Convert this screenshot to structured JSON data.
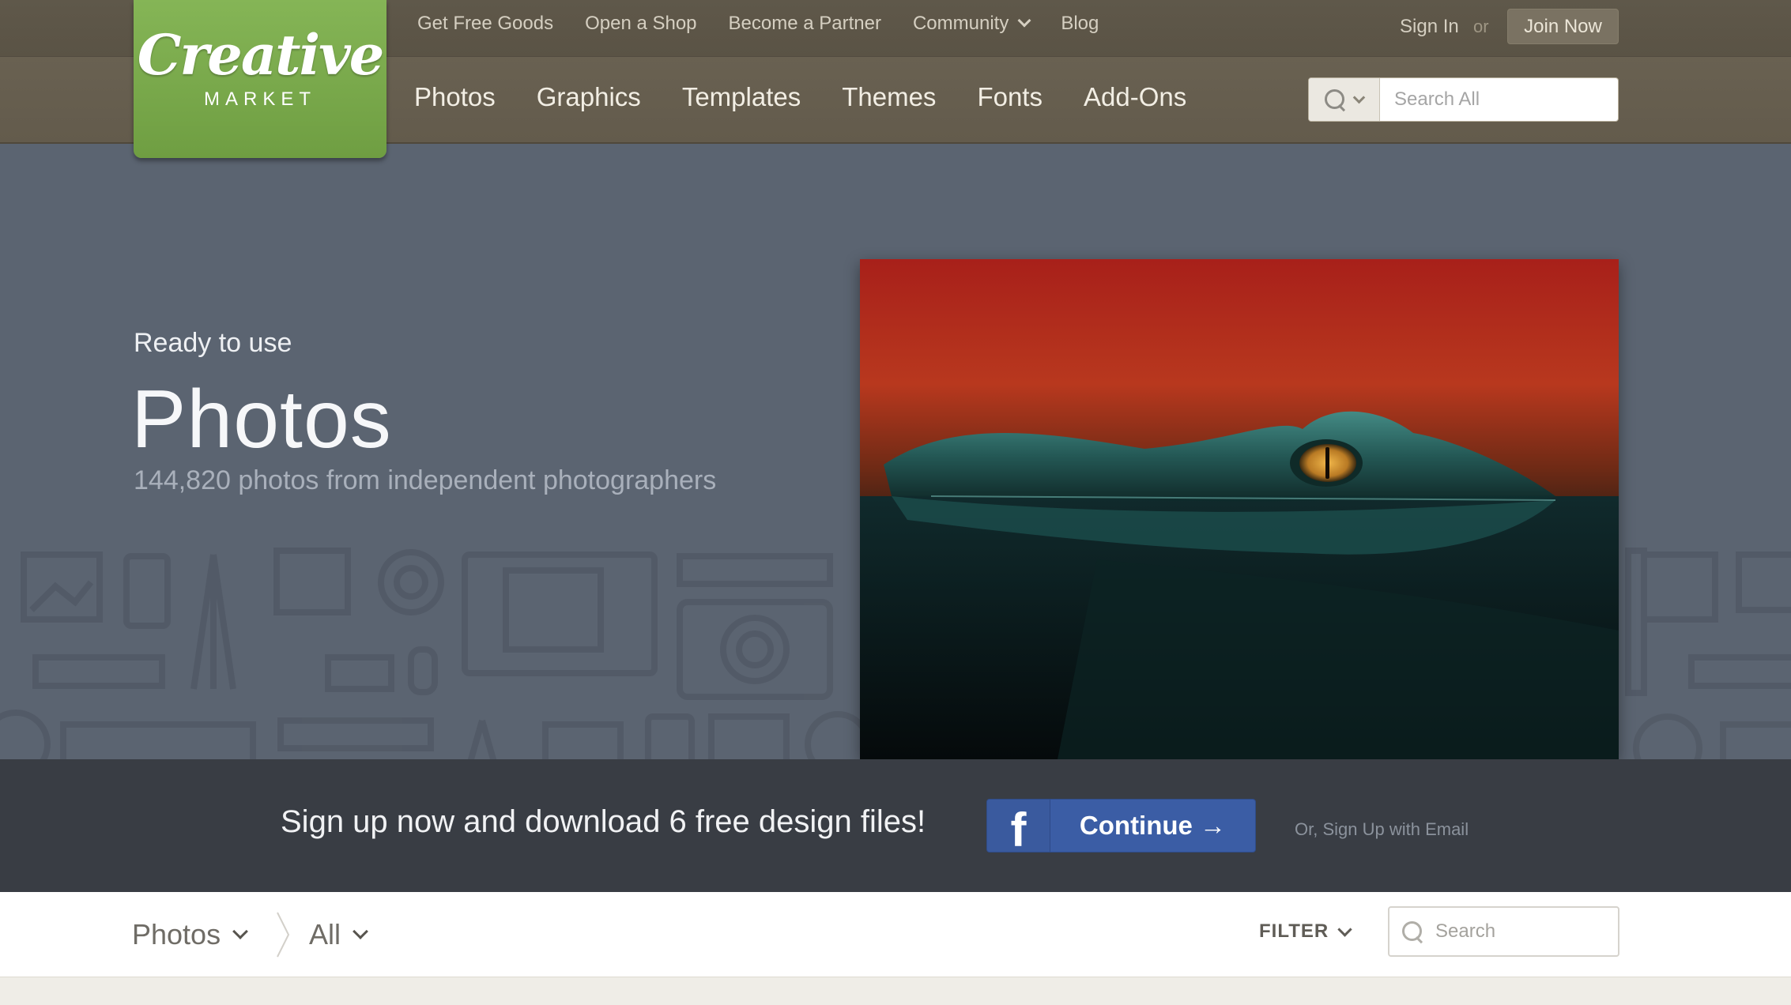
{
  "brand": {
    "logo_script": "Creative",
    "logo_sub": "MARKET",
    "accent": "#7aab4c"
  },
  "top_nav": [
    {
      "label": "Get Free Goods"
    },
    {
      "label": "Open a Shop"
    },
    {
      "label": "Become a Partner"
    },
    {
      "label": "Community",
      "has_dropdown": true
    },
    {
      "label": "Blog"
    }
  ],
  "account": {
    "sign_in": "Sign In",
    "or": "or",
    "join": "Join Now"
  },
  "main_nav": [
    "Photos",
    "Graphics",
    "Templates",
    "Themes",
    "Fonts",
    "Add-Ons"
  ],
  "search": {
    "placeholder": "Search All",
    "icon": "search-icon"
  },
  "hero": {
    "kicker": "Ready to use",
    "title": "Photos",
    "subtitle": "144,820 photos from independent photographers",
    "image_alt": "crocodile-eye-photo"
  },
  "signup": {
    "text": "Sign up now and download 6 free design files!",
    "fb_icon": "f",
    "button": "Continue →",
    "email_link": "Or, Sign Up with Email",
    "fb_color": "#3b5da5"
  },
  "filterbar": {
    "category": "Photos",
    "subcategory": "All",
    "filter": "FILTER",
    "search_placeholder": "Search"
  }
}
